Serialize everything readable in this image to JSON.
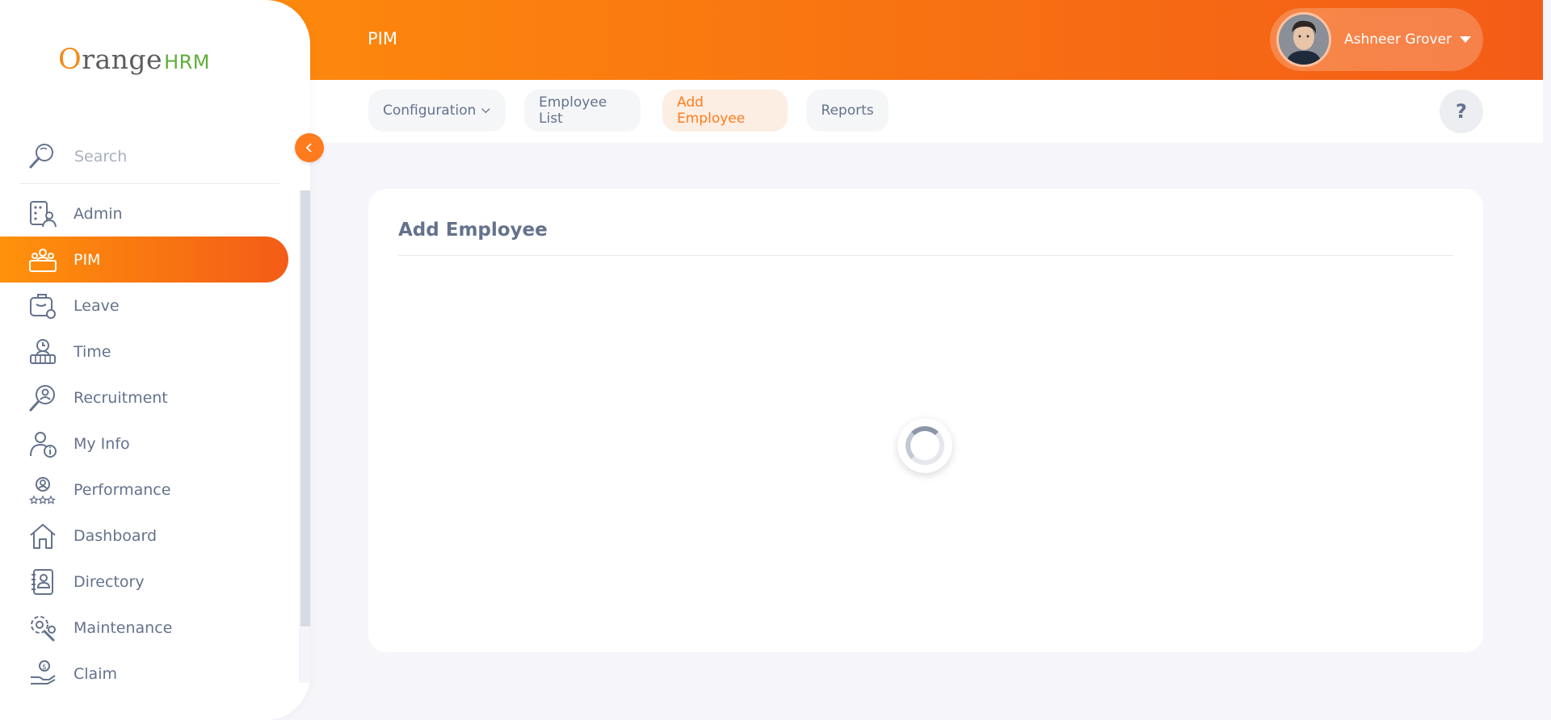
{
  "app": {
    "brand_main": "range",
    "brand_o": "O",
    "brand_suffix": "HRM"
  },
  "sidebar": {
    "search_placeholder": "Search",
    "items": [
      {
        "label": "Admin",
        "icon": "admin-icon"
      },
      {
        "label": "PIM",
        "icon": "pim-icon",
        "active": true
      },
      {
        "label": "Leave",
        "icon": "leave-icon"
      },
      {
        "label": "Time",
        "icon": "time-icon"
      },
      {
        "label": "Recruitment",
        "icon": "recruitment-icon"
      },
      {
        "label": "My Info",
        "icon": "my-info-icon"
      },
      {
        "label": "Performance",
        "icon": "performance-icon"
      },
      {
        "label": "Dashboard",
        "icon": "dashboard-icon"
      },
      {
        "label": "Directory",
        "icon": "directory-icon"
      },
      {
        "label": "Maintenance",
        "icon": "maintenance-icon"
      },
      {
        "label": "Claim",
        "icon": "claim-icon"
      }
    ]
  },
  "header": {
    "module_title": "PIM",
    "user_name": "Ashneer Grover"
  },
  "tabs": [
    {
      "label": "Configuration"
    },
    {
      "label": "Employee List"
    },
    {
      "label": "Add Employee",
      "active": true
    },
    {
      "label": "Reports"
    }
  ],
  "help": {
    "label": "?"
  },
  "main": {
    "card_title": "Add Employee",
    "state": "loading"
  },
  "colors": {
    "accent": "#ff7b1d",
    "gradient_start": "#ff920b",
    "gradient_end": "#f35c17",
    "text": "#64728c"
  }
}
